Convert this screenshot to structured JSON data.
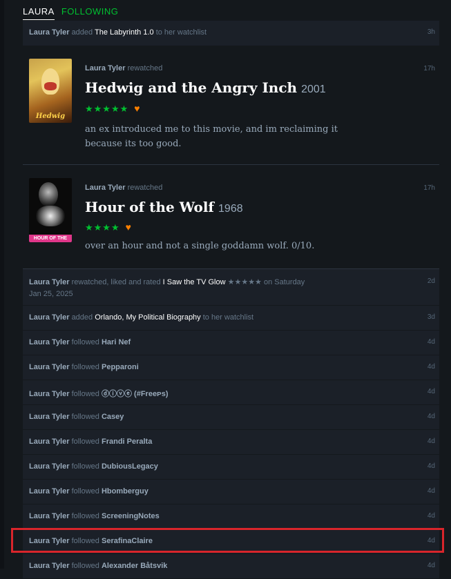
{
  "tabs": {
    "laura": "LAURA",
    "following": "FOLLOWING"
  },
  "top_item": {
    "user": "Laura Tyler",
    "verb": "added",
    "item": "The Labyrinth 1.0",
    "suffix": "to her watchlist",
    "time": "3h"
  },
  "reviews": [
    {
      "user": "Laura Tyler",
      "verb": "rewatched",
      "time": "17h",
      "title": "Hedwig and the Angry Inch",
      "year": "2001",
      "stars": "★★★★★",
      "heart": "♥",
      "body": "an ex introduced me to this movie, and im reclaiming it because its too good.",
      "poster_caption": "Hedwig"
    },
    {
      "user": "Laura Tyler",
      "verb": "rewatched",
      "time": "17h",
      "title": "Hour of the Wolf",
      "year": "1968",
      "stars": "★★★★",
      "heart": "♥",
      "body": "over an hour and not a single goddamn wolf. 0/10.",
      "poster_caption": "HOUR OF THE WOLF"
    }
  ],
  "activity": [
    {
      "user": "Laura Tyler",
      "verb": "rewatched, liked and rated",
      "item": "I Saw the TV Glow",
      "stars": "★★★★★",
      "suffix": "on Saturday",
      "line2": "Jan 25, 2025",
      "time": "2d"
    },
    {
      "user": "Laura Tyler",
      "verb": "added",
      "item": "Orlando, My Political Biography",
      "suffix": "to her watchlist",
      "time": "3d"
    },
    {
      "user": "Laura Tyler",
      "verb": "followed",
      "item": "Hari Nef",
      "time": "4d"
    },
    {
      "user": "Laura Tyler",
      "verb": "followed",
      "item": "Pepparoni",
      "time": "4d"
    },
    {
      "user": "Laura Tyler",
      "verb": "followed",
      "item": "ⓓⓘⓥⓔ (#Freeᴘs)",
      "time": "4d"
    },
    {
      "user": "Laura Tyler",
      "verb": "followed",
      "item": "Casey",
      "time": "4d"
    },
    {
      "user": "Laura Tyler",
      "verb": "followed",
      "item": "Frandi Peralta",
      "time": "4d"
    },
    {
      "user": "Laura Tyler",
      "verb": "followed",
      "item": "DubiousLegacy",
      "time": "4d"
    },
    {
      "user": "Laura Tyler",
      "verb": "followed",
      "item": "Hbomberguy",
      "time": "4d"
    },
    {
      "user": "Laura Tyler",
      "verb": "followed",
      "item": "ScreeningNotes",
      "time": "4d"
    },
    {
      "user": "Laura Tyler",
      "verb": "followed",
      "item": "SerafinaClaire",
      "time": "4d"
    },
    {
      "user": "Laura Tyler",
      "verb": "followed",
      "item": "Alexander Båtsvik",
      "time": "4d"
    }
  ],
  "colors": {
    "background": "#14181c",
    "row": "#1b2028",
    "accent_green": "#00c030",
    "heart_orange": "#ff8000",
    "highlight": "#d9252b"
  }
}
